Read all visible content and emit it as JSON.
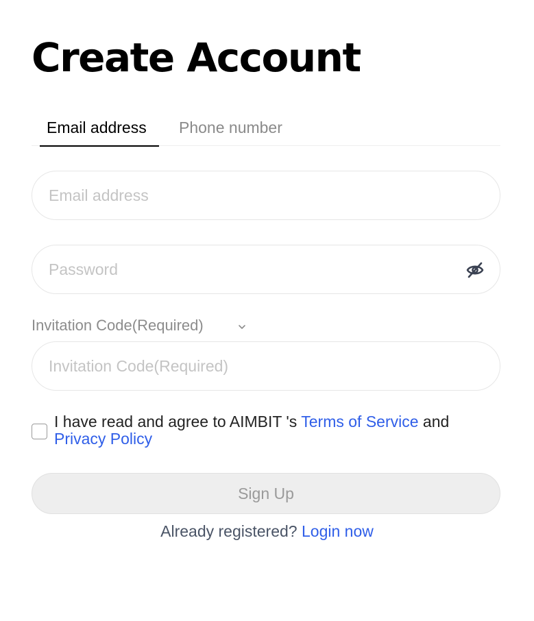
{
  "title": "Create Account",
  "tabs": {
    "email_label": "Email address",
    "phone_label": "Phone number",
    "active": "Email address"
  },
  "email_field": {
    "placeholder": "Email address",
    "value": ""
  },
  "password_field": {
    "placeholder": "Password",
    "value": "",
    "toggle_icon": "eye-off-icon"
  },
  "invitation": {
    "label": "Invitation Code(Required)",
    "toggle_icon": "chevron-down-icon",
    "placeholder": "Invitation Code(Required)",
    "value": ""
  },
  "agreement": {
    "checked": false,
    "prefix": "I have read and agree to AIMBIT 's ",
    "terms_link": "Terms of Service",
    "and": " and ",
    "privacy_link": "Privacy Policy"
  },
  "signup_button": "Sign Up",
  "login_prompt": {
    "text": "Already registered? ",
    "link": "Login now"
  },
  "colors": {
    "link": "#2f5ee8",
    "button_bg": "#eeeeee",
    "placeholder": "#c4c4c4",
    "muted": "#8a8a8a"
  }
}
